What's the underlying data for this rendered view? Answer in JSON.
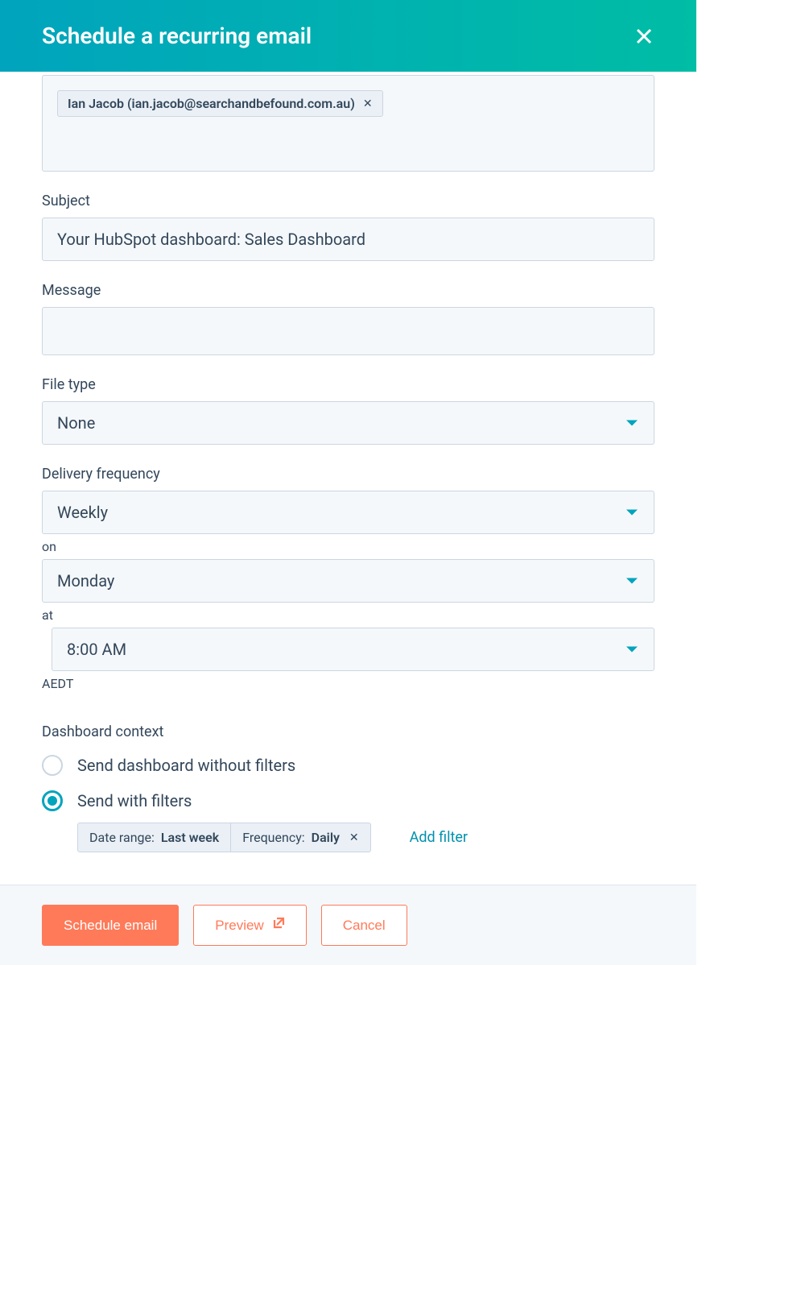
{
  "header": {
    "title": "Schedule a recurring email"
  },
  "recipients": {
    "chip": "Ian Jacob (ian.jacob@searchandbefound.com.au)"
  },
  "subject": {
    "label": "Subject",
    "value": "Your HubSpot dashboard: Sales Dashboard"
  },
  "message": {
    "label": "Message",
    "value": ""
  },
  "fileType": {
    "label": "File type",
    "value": "None"
  },
  "delivery": {
    "label": "Delivery frequency",
    "freq": "Weekly",
    "onLabel": "on",
    "day": "Monday",
    "atLabel": "at",
    "time": "8:00 AM",
    "tz": "AEDT"
  },
  "context": {
    "label": "Dashboard context",
    "opt1": "Send dashboard without filters",
    "opt2": "Send with filters",
    "selected": "with",
    "filters": {
      "dateRangeKey": "Date range:",
      "dateRangeVal": "Last week",
      "frequencyKey": "Frequency:",
      "frequencyVal": "Daily"
    },
    "addFilter": "Add filter"
  },
  "footer": {
    "schedule": "Schedule email",
    "preview": "Preview",
    "cancel": "Cancel"
  }
}
